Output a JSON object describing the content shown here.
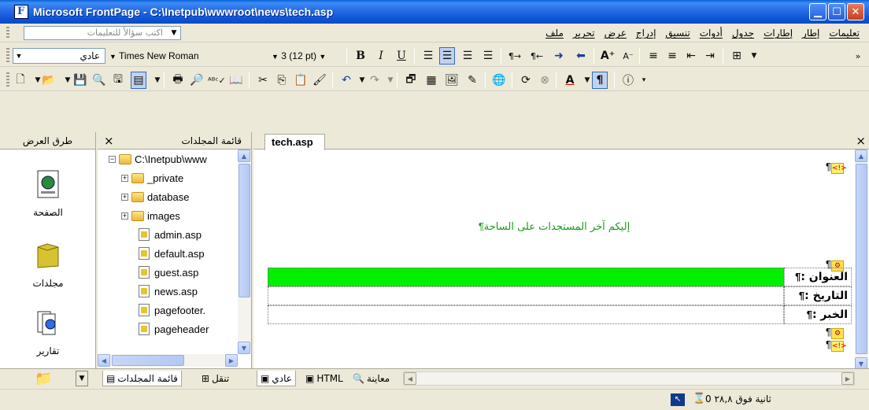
{
  "window": {
    "title": "Microsoft FrontPage - C:\\Inetpub\\wwwroot\\news\\tech.asp"
  },
  "menu": {
    "ask_placeholder": "اكتب سؤالاً للتعليمات",
    "items": [
      "ملف",
      "تحرير",
      "عرض",
      "إدراج",
      "تنسيق",
      "أدوات",
      "جدول",
      "إطارات",
      "إطار",
      "تعليمات"
    ]
  },
  "format_toolbar": {
    "style_value": "عادي",
    "font_value": "Times New Roman",
    "size_value": "3 (12 pt)"
  },
  "views_panel": {
    "header": "طرق العرض",
    "items": [
      {
        "label": "الصفحة",
        "icon": "page-view-icon"
      },
      {
        "label": "مجلدات",
        "icon": "folders-view-icon"
      },
      {
        "label": "تقارير",
        "icon": "reports-view-icon"
      }
    ]
  },
  "folder_panel": {
    "header": "قائمة المجلدات",
    "close": "×",
    "root": "C:\\Inetpub\\www",
    "folders": [
      "_private",
      "database",
      "images"
    ],
    "files": [
      "admin.asp",
      "default.asp",
      "guest.asp",
      "news.asp",
      "pagefooter.",
      "pageheader"
    ]
  },
  "editor": {
    "tab": "tech.asp",
    "close": "×",
    "heading": "إليكم آخر المستجدات على الساحة",
    "rows": [
      {
        "label": "العنوان :",
        "highlight": true
      },
      {
        "label": "التاريخ :",
        "highlight": false
      },
      {
        "label": "الخبر :",
        "highlight": false
      }
    ],
    "para_mark": "¶",
    "asp_mark": "<!>"
  },
  "bottom_left": {
    "nav_tab": "تنقل",
    "folder_tab": "قائمة المجلدات"
  },
  "bottom_editor": {
    "normal_tab": "عادي",
    "html_tab": "HTML",
    "preview_tab": "معاينة"
  },
  "status": {
    "download_time": "ثانية فوق ٢٨,٨ 0"
  },
  "colors": {
    "title_bar": "#0b55d4",
    "highlight": "#00f000",
    "heading_text": "#1c9a1c"
  }
}
